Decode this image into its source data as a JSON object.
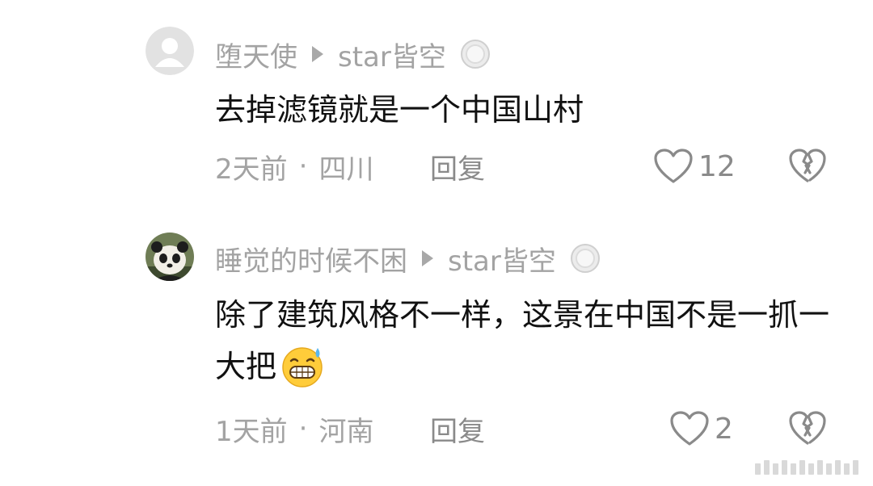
{
  "comments": [
    {
      "username": "堕天使",
      "reply_to": "star皆空",
      "text": "去掉滤镜就是一个中国山村",
      "time": "2天前",
      "location": "四川",
      "reply_label": "回复",
      "likes": "12",
      "avatar": "default-avatar-icon"
    },
    {
      "username": "睡觉的时候不困",
      "reply_to": "star皆空",
      "text": "除了建筑风格不一样，这景在中国不是一抓一大把",
      "time": "1天前",
      "location": "河南",
      "reply_label": "回复",
      "likes": "2",
      "avatar": "panda-avatar"
    }
  ],
  "separator": "·",
  "colors": {
    "meta_text": "#a3a3a3",
    "body_text": "#111111",
    "icon_gray": "#8a8a8a"
  }
}
